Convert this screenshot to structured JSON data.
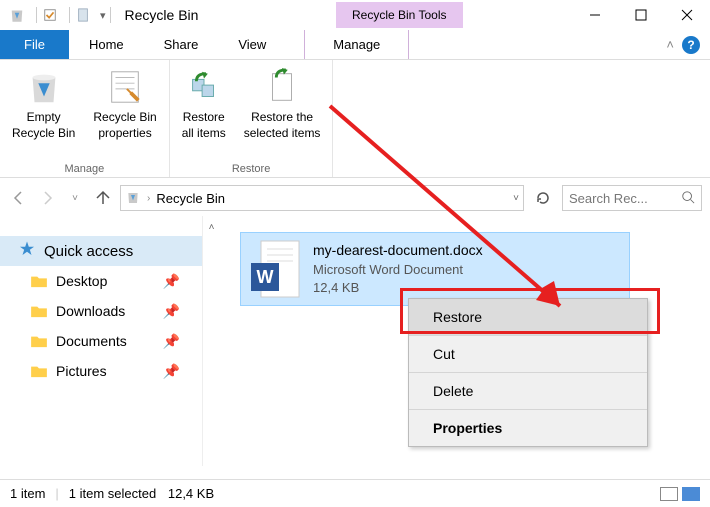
{
  "titlebar": {
    "title": "Recycle Bin",
    "tools_tab": "Recycle Bin Tools"
  },
  "menubar": {
    "file": "File",
    "home": "Home",
    "share": "Share",
    "view": "View",
    "manage": "Manage"
  },
  "ribbon": {
    "manage_group": "Manage",
    "restore_group": "Restore",
    "empty": "Empty\nRecycle Bin",
    "props": "Recycle Bin\nproperties",
    "restore_all": "Restore\nall items",
    "restore_sel": "Restore the\nselected items"
  },
  "address": {
    "location": "Recycle Bin"
  },
  "search": {
    "placeholder": "Search Rec..."
  },
  "sidebar": {
    "quick": "Quick access",
    "items": [
      "Desktop",
      "Downloads",
      "Documents",
      "Pictures"
    ]
  },
  "file": {
    "name": "my-dearest-document.docx",
    "type": "Microsoft Word Document",
    "size": "12,4 KB"
  },
  "context": {
    "restore": "Restore",
    "cut": "Cut",
    "delete": "Delete",
    "properties": "Properties"
  },
  "status": {
    "count": "1 item",
    "selected": "1 item selected",
    "size": "12,4 KB"
  }
}
